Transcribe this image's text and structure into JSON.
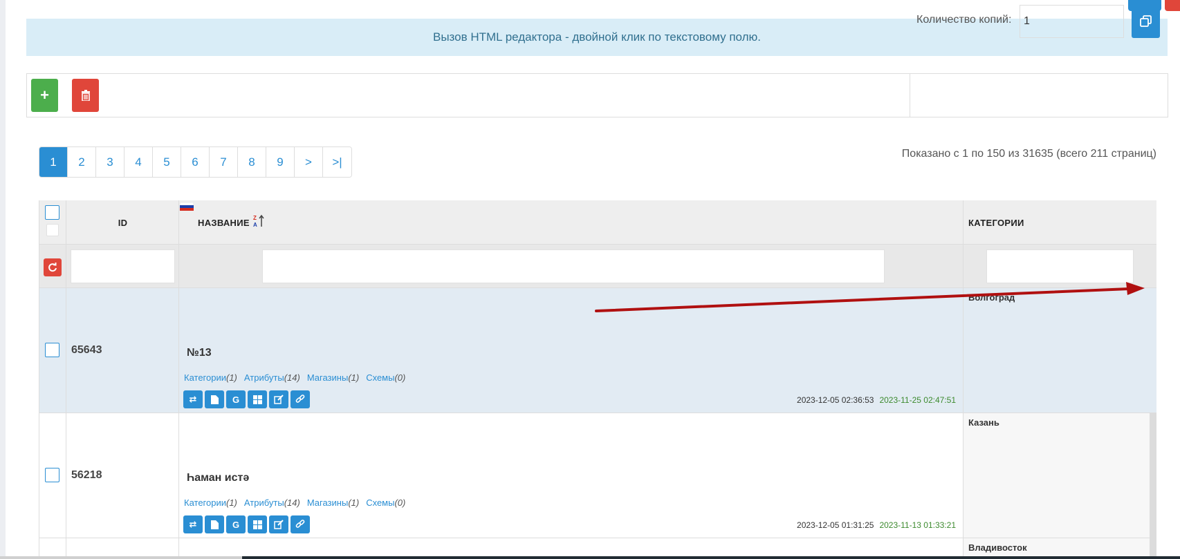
{
  "info_alert": "Вызов HTML редактора - двойной клик по текстовому полю.",
  "toolbar": {
    "copies_label": "Количество копий:",
    "copies_value": "1"
  },
  "pagination": {
    "pages": [
      "1",
      "2",
      "3",
      "4",
      "5",
      "6",
      "7",
      "8",
      "9",
      ">",
      ">|"
    ],
    "active": "1"
  },
  "results_text": "Показано с 1 по 150 из 31635 (всего 211 страниц)",
  "table": {
    "columns": {
      "id": "ID",
      "name": "НАЗВАНИЕ",
      "categories": "КАТЕГОРИИ"
    },
    "rows": [
      {
        "id": "65643",
        "name": "№13",
        "links": [
          {
            "label": "Категории",
            "count": "(1)"
          },
          {
            "label": "Атрибуты",
            "count": "(14)"
          },
          {
            "label": "Магазины",
            "count": "(1)"
          },
          {
            "label": "Схемы",
            "count": "(0)"
          }
        ],
        "modified": "2023-12-05 02:36:53",
        "created": "2023-11-25 02:47:51",
        "category": "Волгоград"
      },
      {
        "id": "56218",
        "name": "Һаман истә",
        "links": [
          {
            "label": "Категории",
            "count": "(1)"
          },
          {
            "label": "Атрибуты",
            "count": "(14)"
          },
          {
            "label": "Магазины",
            "count": "(1)"
          },
          {
            "label": "Схемы",
            "count": "(0)"
          }
        ],
        "modified": "2023-12-05 01:31:25",
        "created": "2023-11-13 01:33:21",
        "category": "Казань"
      },
      {
        "category": "Владивосток"
      }
    ]
  },
  "action_icons": [
    "exchange-icon",
    "file-icon",
    "google-icon",
    "windows-icon",
    "edit-icon",
    "link-icon"
  ],
  "colors": {
    "primary": "#2a8ed3",
    "success": "#4cae4c",
    "danger": "#e0463a",
    "info_bg": "#d9edf7",
    "annotation_arrow": "#b01010"
  }
}
